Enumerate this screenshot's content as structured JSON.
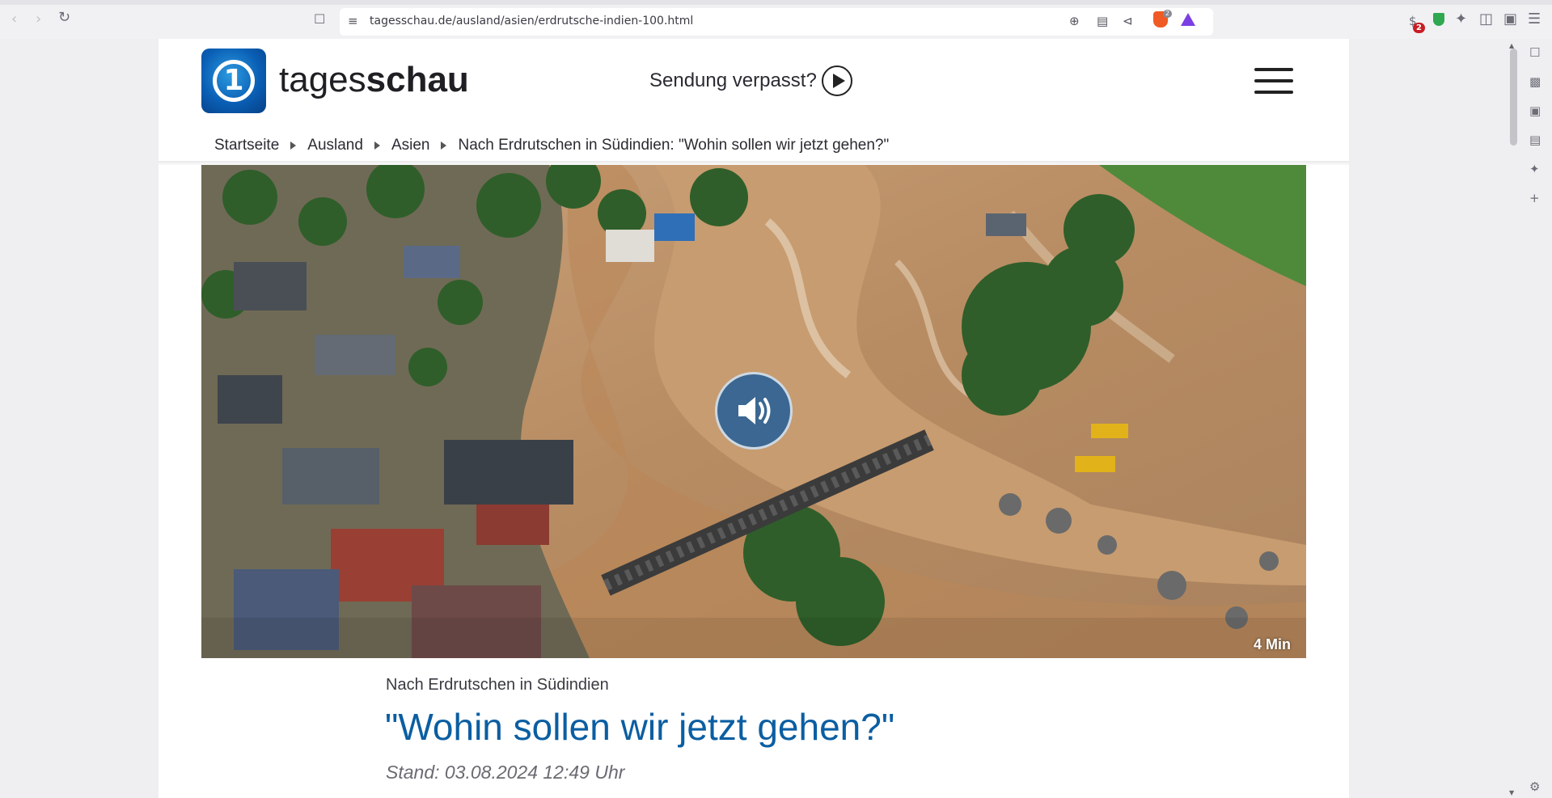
{
  "browser": {
    "url": "tagesschau.de/ausland/asien/erdrutsche-indien-100.html",
    "brave_badge": "2",
    "wallet_badge": "2",
    "icons": [
      "back-icon",
      "forward-icon",
      "reload-icon",
      "bookmark-icon",
      "site-info-icon",
      "zoom-icon",
      "reader-icon",
      "share-icon",
      "brave-shields-icon",
      "brave-rewards-icon",
      "wallet-icon",
      "vpn-shield-icon",
      "extensions-icon",
      "sidebar-toggle-icon",
      "wallet-panel-icon",
      "menu-icon"
    ]
  },
  "sidebar": {
    "icons": [
      "bookmarks-icon",
      "media-icon",
      "wallet-icon",
      "reading-list-icon",
      "leo-ai-icon",
      "add-icon",
      "settings-icon"
    ]
  },
  "header": {
    "brand_light": "tages",
    "brand_bold": "schau",
    "logo_text": "1",
    "missed_label": "Sendung verpasst?"
  },
  "breadcrumb": {
    "items": [
      "Startseite",
      "Ausland",
      "Asien",
      "Nach Erdrutschen in Südindien: \"Wohin sollen wir jetzt gehen?\""
    ]
  },
  "media": {
    "duration": "4 Min"
  },
  "article": {
    "topline": "Nach Erdrutschen in Südindien",
    "headline": "\"Wohin sollen wir jetzt gehen?\"",
    "stand": "Stand: 03.08.2024 12:49 Uhr"
  },
  "colors": {
    "headline": "#0b5ea2",
    "logo_blue": "#0a5fb5",
    "brave_orange": "#f05a24"
  }
}
